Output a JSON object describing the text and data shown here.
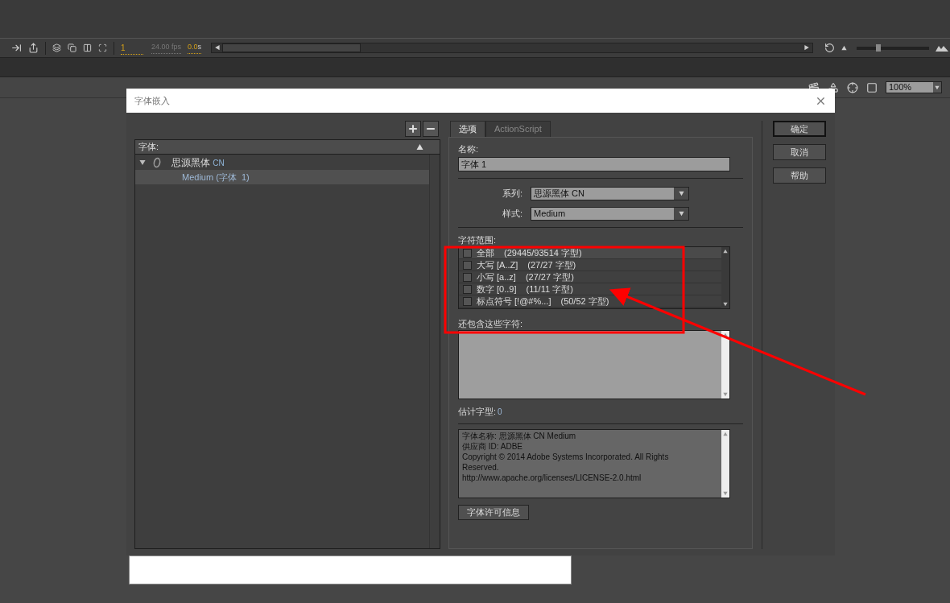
{
  "toolbar": {
    "frame": "1",
    "fps": "24.00 fps",
    "time": "0.0",
    "time_unit": "s",
    "zoom": "100%",
    "zoom_slider": {
      "level": 0.3
    }
  },
  "dialog": {
    "title": "字体嵌入",
    "font_list": {
      "header": "字体:",
      "items": [
        {
          "name": "思源黑体",
          "suffix": "CN",
          "expanded": true,
          "children": [
            {
              "label": "Medium (字体  1)",
              "selected": true
            }
          ]
        }
      ]
    },
    "tabs": [
      {
        "label": "选项",
        "selected": true
      },
      {
        "label": "ActionScript",
        "selected": false
      }
    ],
    "name_label": "名称:",
    "name_value": "字体 1",
    "family_label": "系列:",
    "family_value": "思源黑体 CN",
    "style_label": "样式:",
    "style_value": "Medium",
    "range_label": "字符范围:",
    "ranges": [
      {
        "label": "全部",
        "detail": "(29445/93514 字型)",
        "checked": false
      },
      {
        "label": "大写 [A..Z]",
        "detail": "(27/27 字型)",
        "checked": false
      },
      {
        "label": "小写 [a..z]",
        "detail": "(27/27 字型)",
        "checked": false
      },
      {
        "label": "数字 [0..9]",
        "detail": "(11/11 字型)",
        "checked": false
      },
      {
        "label": "标点符号 [!@#%...]",
        "detail": "(50/52 字型)",
        "checked": false
      }
    ],
    "extra_label": "还包含这些字符:",
    "estimate_label": "估计字型:",
    "estimate_value": "0",
    "info_lines": [
      "字体名称: 思源黑体 CN Medium",
      "供应商 ID: ADBE",
      "Copyright © 2014 Adobe Systems Incorporated. All Rights",
      "Reserved.",
      "http://www.apache.org/licenses/LICENSE-2.0.html"
    ],
    "license_button": "字体许可信息",
    "buttons": [
      {
        "label": "确定",
        "default": true
      },
      {
        "label": "取消",
        "default": false
      },
      {
        "label": "帮助",
        "default": false
      }
    ]
  }
}
